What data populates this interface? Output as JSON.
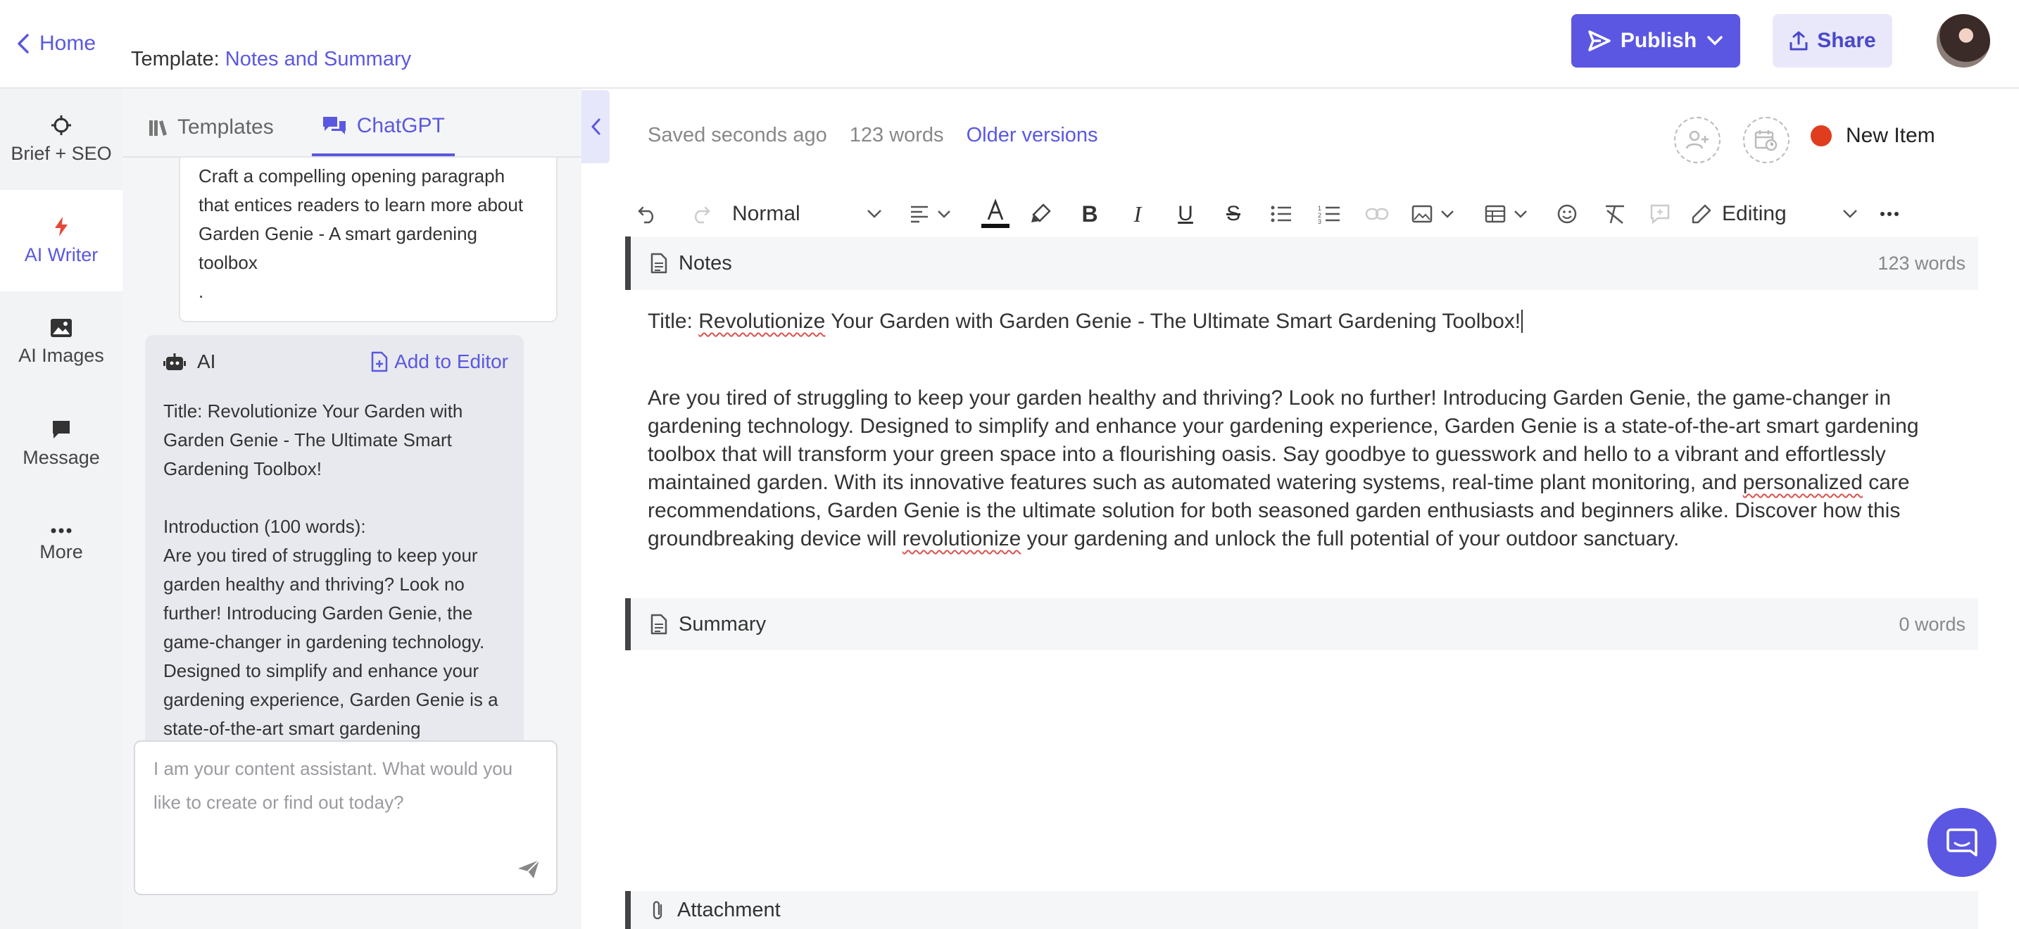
{
  "header": {
    "home_label": "Home",
    "template_prefix": "Template:",
    "template_name": "Notes and Summary",
    "publish_label": "Publish",
    "share_label": "Share"
  },
  "rail": {
    "items": [
      {
        "label": "Brief + SEO",
        "icon": "crosshair-icon"
      },
      {
        "label": "AI Writer",
        "icon": "lightning-icon"
      },
      {
        "label": "AI Images",
        "icon": "image-icon"
      },
      {
        "label": "Message",
        "icon": "chat-bubble-icon"
      },
      {
        "label": "More",
        "icon": "dots-icon"
      }
    ]
  },
  "panel": {
    "tabs": [
      {
        "label": "Templates"
      },
      {
        "label": "ChatGPT"
      }
    ],
    "prompt_text": "Craft a compelling opening paragraph that entices readers to learn more about Garden Genie - A smart gardening toolbox\n.",
    "ai_label": "AI",
    "add_to_editor": "Add to Editor",
    "ai_response": "Title: Revolutionize Your Garden with Garden Genie - The Ultimate Smart Gardening Toolbox!\n\nIntroduction (100 words):\nAre you tired of struggling to keep your garden healthy and thriving? Look no further! Introducing Garden Genie, the game-changer in gardening technology. Designed to simplify and enhance your gardening experience, Garden Genie is a state-of-the-art smart gardening",
    "chat_placeholder": "I am your content assistant. What would you like to create or find out today?"
  },
  "editor": {
    "saved": "Saved seconds ago",
    "words": "123 words",
    "older_versions": "Older versions",
    "status_label": "New Item",
    "status_color": "#e03d1e",
    "style_select": "Normal",
    "mode_select": "Editing",
    "sections": {
      "notes": {
        "label": "Notes",
        "count": "123 words"
      },
      "summary": {
        "label": "Summary",
        "count": "0 words"
      },
      "attachment": {
        "label": "Attachment"
      }
    },
    "doc": {
      "title_prefix": "Title: ",
      "title_mis": "Revolutionize",
      "title_rest": " Your Garden with Garden Genie - The Ultimate Smart Gardening Toolbox!",
      "p1": "Are you tired of struggling to keep your garden healthy and thriving? Look no further! Introducing Garden Genie, the game-changer in gardening technology. Designed to simplify and enhance your gardening experience, Garden Genie is a state-of-the-art smart gardening toolbox that will transform your green space into a flourishing oasis. Say goodbye to guesswork and hello to a vibrant and effortlessly maintained garden. With its innovative features such as automated watering systems, real-time plant monitoring, and ",
      "p1_mis": "personalized",
      "p2": " care recommendations, Garden Genie is the ultimate solution for both seasoned garden enthusiasts and beginners alike. Discover how this groundbreaking device will ",
      "p2_mis": "revolutionize",
      "p3": " your gardening and unlock the full potential of your outdoor sanctuary."
    }
  },
  "colors": {
    "accent": "#5b57e3",
    "rail_bg": "#f2f3f5"
  }
}
